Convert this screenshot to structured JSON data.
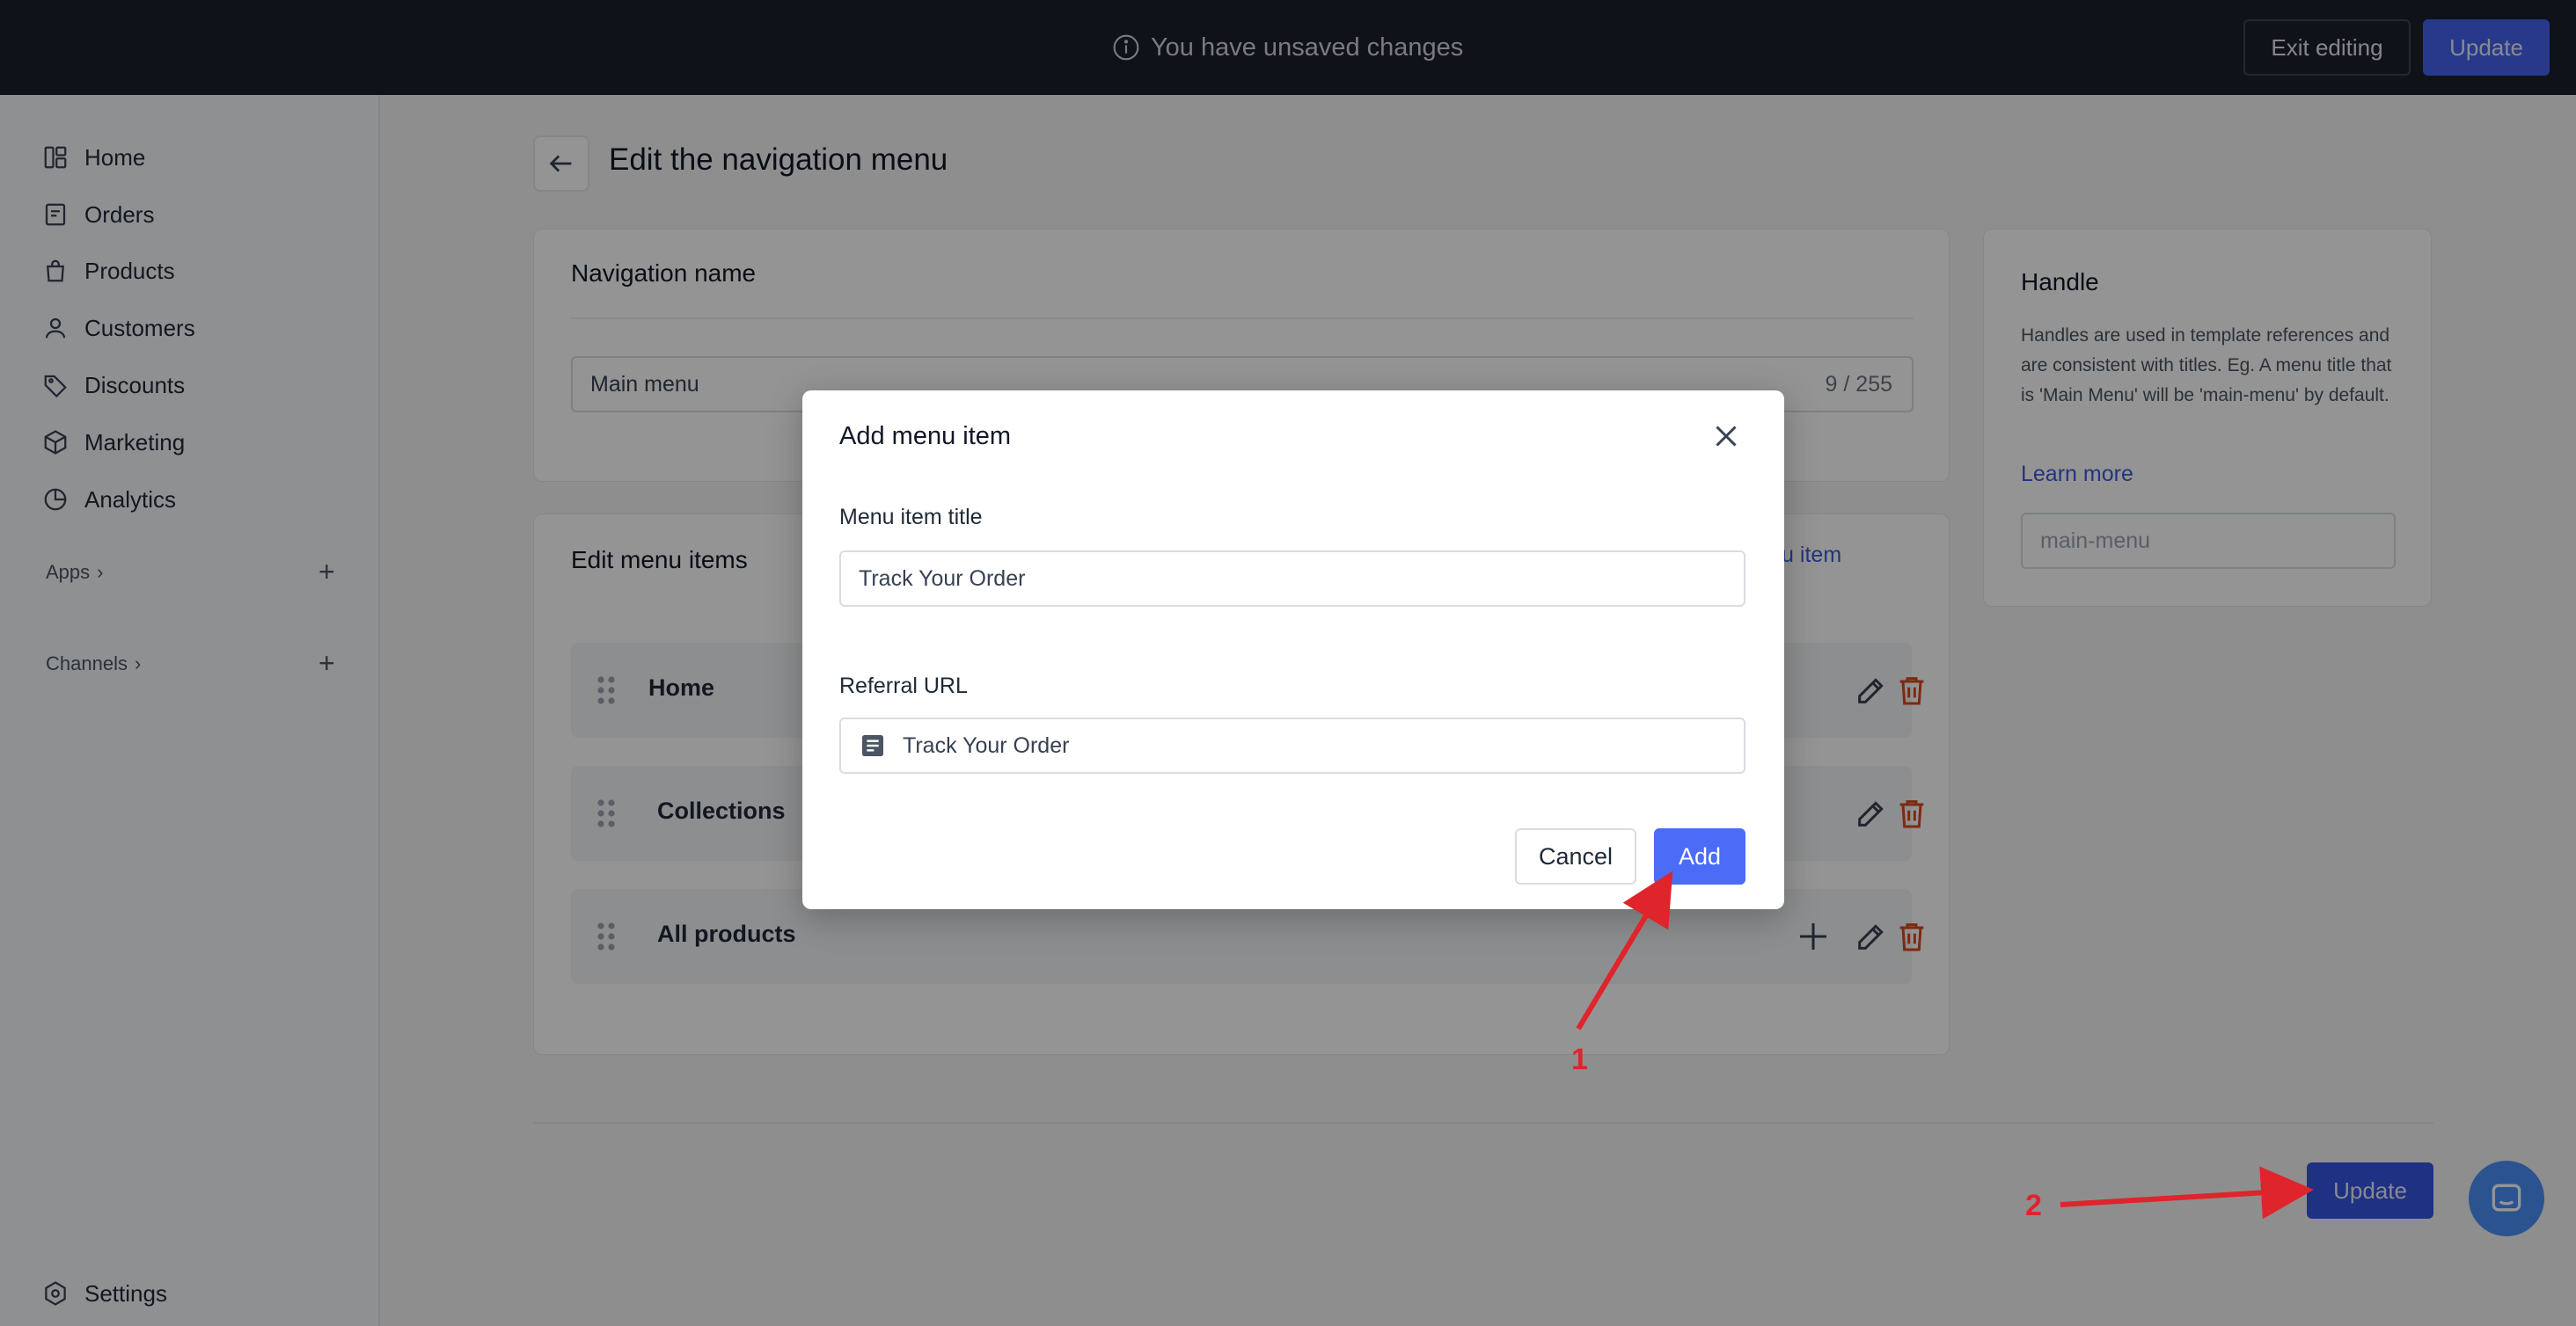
{
  "topbar": {
    "unsaved_text": "You have unsaved changes",
    "exit_label": "Exit editing",
    "update_label": "Update"
  },
  "sidebar": {
    "items": [
      {
        "label": "Home",
        "icon": "home-icon"
      },
      {
        "label": "Orders",
        "icon": "orders-icon"
      },
      {
        "label": "Products",
        "icon": "products-icon"
      },
      {
        "label": "Customers",
        "icon": "customers-icon"
      },
      {
        "label": "Discounts",
        "icon": "discounts-icon"
      },
      {
        "label": "Marketing",
        "icon": "marketing-icon"
      },
      {
        "label": "Analytics",
        "icon": "analytics-icon"
      }
    ],
    "apps_label": "Apps",
    "channels_label": "Channels",
    "settings_label": "Settings"
  },
  "main": {
    "title": "Edit the navigation menu",
    "nav_card": {
      "title": "Navigation name",
      "value": "Main menu",
      "counter": "9 / 255"
    },
    "items_card": {
      "title": "Edit menu items",
      "add_link": "Add menu item",
      "rows": [
        {
          "label": "Home"
        },
        {
          "label": "Collections"
        },
        {
          "label": "All products"
        }
      ]
    },
    "handle_card": {
      "title": "Handle",
      "description": "Handles are used in template references and are consistent with titles. Eg. A menu title that is 'Main Menu' will be 'main-menu' by default.",
      "learn_more": "Learn more",
      "placeholder": "main-menu"
    },
    "update_label": "Update"
  },
  "modal": {
    "title": "Add menu item",
    "title_label": "Menu item title",
    "title_value": "Track Your Order",
    "url_label": "Referral URL",
    "url_value": "Track Your Order",
    "cancel_label": "Cancel",
    "add_label": "Add"
  },
  "annotations": {
    "step1": "1",
    "step2": "2",
    "arrow_color": "#e0242b"
  },
  "colors": {
    "primary": "#4a6cf7",
    "topbar_bg": "#1c1f2b",
    "delete_red": "#d9481c",
    "link_blue": "#3b5bdb"
  }
}
